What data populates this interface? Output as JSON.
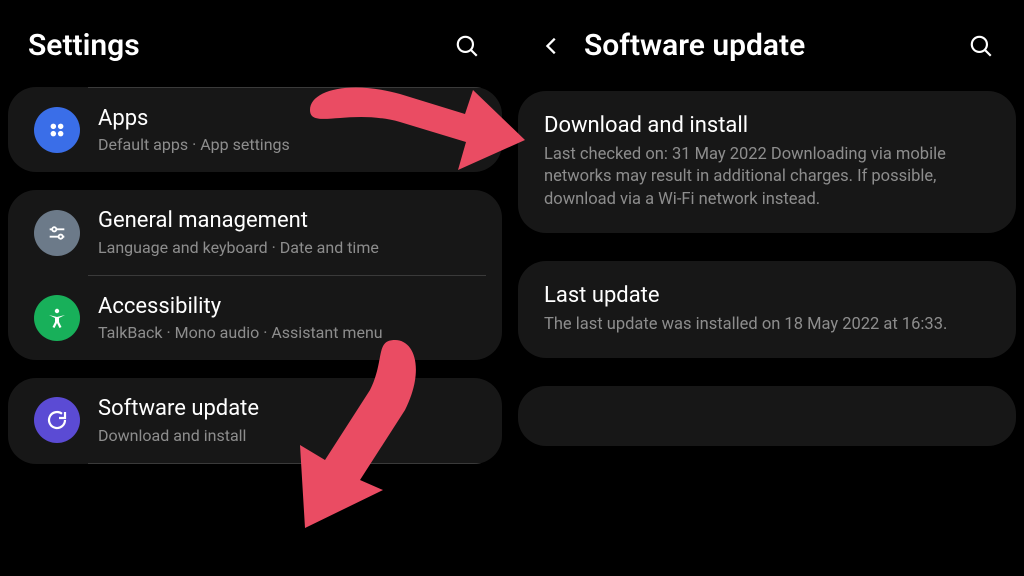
{
  "left": {
    "title": "Settings",
    "apps": {
      "title": "Apps",
      "sub": "Default apps  ·  App settings"
    },
    "general": {
      "title": "General management",
      "sub": "Language and keyboard  ·  Date and time"
    },
    "accessibility": {
      "title": "Accessibility",
      "sub": "TalkBack  ·  Mono audio  ·  Assistant menu"
    },
    "software": {
      "title": "Software update",
      "sub": "Download and install"
    }
  },
  "right": {
    "title": "Software update",
    "download": {
      "title": "Download and install",
      "body": "Last checked on: 31 May 2022\nDownloading via mobile networks may result in additional charges. If possible, download via a Wi-Fi network instead."
    },
    "last": {
      "title": "Last update",
      "body": "The last update was installed on 18 May 2022 at 16:33."
    }
  }
}
